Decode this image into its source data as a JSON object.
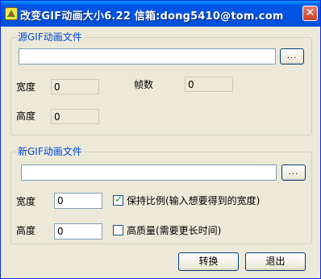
{
  "window": {
    "title": "改变GIF动画大小6.22  信箱:dong5410@tom.com",
    "close_glyph": "✕"
  },
  "source": {
    "group_label": "源GIF动画文件",
    "path_value": "",
    "browse_label": "...",
    "width_label": "宽度",
    "width_value": "0",
    "height_label": "高度",
    "height_value": "0",
    "frames_label": "帧数",
    "frames_value": "0"
  },
  "target": {
    "group_label": "新GIF动画文件",
    "path_value": "",
    "browse_label": "...",
    "width_label": "宽度",
    "width_value": "0",
    "height_label": "高度",
    "height_value": "0",
    "keep_ratio_label": "保持比例(输入想要得到的宽度)",
    "keep_ratio_checked": true,
    "high_quality_label": "高质量(需要更长时间)",
    "high_quality_checked": false
  },
  "buttons": {
    "convert_label": "转换",
    "exit_label": "退出"
  },
  "colors": {
    "titlebar": "#0055e5",
    "group_label": "#0046d5",
    "face": "#ece9d8"
  },
  "icons": {
    "app": "gif-app-icon",
    "close": "close-icon",
    "check": "checkmark-icon"
  }
}
